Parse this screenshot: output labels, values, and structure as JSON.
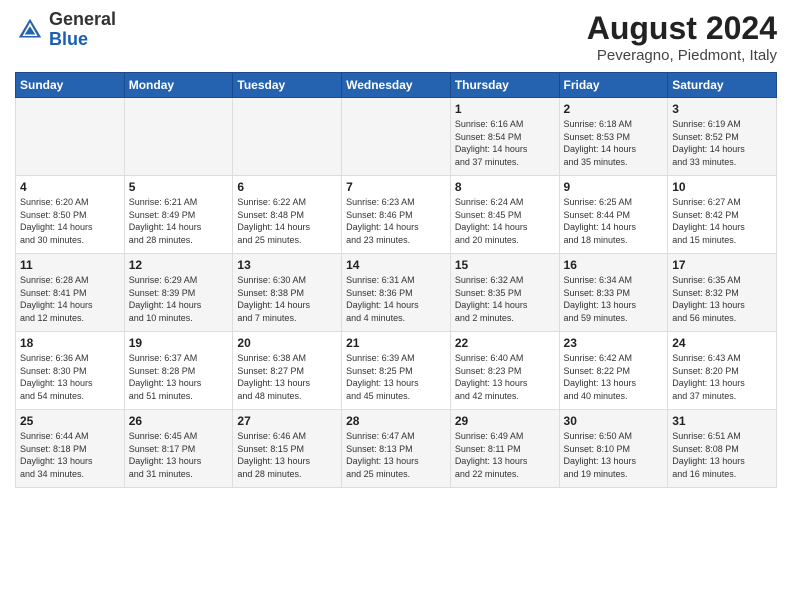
{
  "header": {
    "logo_general": "General",
    "logo_blue": "Blue",
    "month_title": "August 2024",
    "location": "Peveragno, Piedmont, Italy"
  },
  "days_of_week": [
    "Sunday",
    "Monday",
    "Tuesday",
    "Wednesday",
    "Thursday",
    "Friday",
    "Saturday"
  ],
  "weeks": [
    [
      {
        "day": "",
        "info": ""
      },
      {
        "day": "",
        "info": ""
      },
      {
        "day": "",
        "info": ""
      },
      {
        "day": "",
        "info": ""
      },
      {
        "day": "1",
        "info": "Sunrise: 6:16 AM\nSunset: 8:54 PM\nDaylight: 14 hours\nand 37 minutes."
      },
      {
        "day": "2",
        "info": "Sunrise: 6:18 AM\nSunset: 8:53 PM\nDaylight: 14 hours\nand 35 minutes."
      },
      {
        "day": "3",
        "info": "Sunrise: 6:19 AM\nSunset: 8:52 PM\nDaylight: 14 hours\nand 33 minutes."
      }
    ],
    [
      {
        "day": "4",
        "info": "Sunrise: 6:20 AM\nSunset: 8:50 PM\nDaylight: 14 hours\nand 30 minutes."
      },
      {
        "day": "5",
        "info": "Sunrise: 6:21 AM\nSunset: 8:49 PM\nDaylight: 14 hours\nand 28 minutes."
      },
      {
        "day": "6",
        "info": "Sunrise: 6:22 AM\nSunset: 8:48 PM\nDaylight: 14 hours\nand 25 minutes."
      },
      {
        "day": "7",
        "info": "Sunrise: 6:23 AM\nSunset: 8:46 PM\nDaylight: 14 hours\nand 23 minutes."
      },
      {
        "day": "8",
        "info": "Sunrise: 6:24 AM\nSunset: 8:45 PM\nDaylight: 14 hours\nand 20 minutes."
      },
      {
        "day": "9",
        "info": "Sunrise: 6:25 AM\nSunset: 8:44 PM\nDaylight: 14 hours\nand 18 minutes."
      },
      {
        "day": "10",
        "info": "Sunrise: 6:27 AM\nSunset: 8:42 PM\nDaylight: 14 hours\nand 15 minutes."
      }
    ],
    [
      {
        "day": "11",
        "info": "Sunrise: 6:28 AM\nSunset: 8:41 PM\nDaylight: 14 hours\nand 12 minutes."
      },
      {
        "day": "12",
        "info": "Sunrise: 6:29 AM\nSunset: 8:39 PM\nDaylight: 14 hours\nand 10 minutes."
      },
      {
        "day": "13",
        "info": "Sunrise: 6:30 AM\nSunset: 8:38 PM\nDaylight: 14 hours\nand 7 minutes."
      },
      {
        "day": "14",
        "info": "Sunrise: 6:31 AM\nSunset: 8:36 PM\nDaylight: 14 hours\nand 4 minutes."
      },
      {
        "day": "15",
        "info": "Sunrise: 6:32 AM\nSunset: 8:35 PM\nDaylight: 14 hours\nand 2 minutes."
      },
      {
        "day": "16",
        "info": "Sunrise: 6:34 AM\nSunset: 8:33 PM\nDaylight: 13 hours\nand 59 minutes."
      },
      {
        "day": "17",
        "info": "Sunrise: 6:35 AM\nSunset: 8:32 PM\nDaylight: 13 hours\nand 56 minutes."
      }
    ],
    [
      {
        "day": "18",
        "info": "Sunrise: 6:36 AM\nSunset: 8:30 PM\nDaylight: 13 hours\nand 54 minutes."
      },
      {
        "day": "19",
        "info": "Sunrise: 6:37 AM\nSunset: 8:28 PM\nDaylight: 13 hours\nand 51 minutes."
      },
      {
        "day": "20",
        "info": "Sunrise: 6:38 AM\nSunset: 8:27 PM\nDaylight: 13 hours\nand 48 minutes."
      },
      {
        "day": "21",
        "info": "Sunrise: 6:39 AM\nSunset: 8:25 PM\nDaylight: 13 hours\nand 45 minutes."
      },
      {
        "day": "22",
        "info": "Sunrise: 6:40 AM\nSunset: 8:23 PM\nDaylight: 13 hours\nand 42 minutes."
      },
      {
        "day": "23",
        "info": "Sunrise: 6:42 AM\nSunset: 8:22 PM\nDaylight: 13 hours\nand 40 minutes."
      },
      {
        "day": "24",
        "info": "Sunrise: 6:43 AM\nSunset: 8:20 PM\nDaylight: 13 hours\nand 37 minutes."
      }
    ],
    [
      {
        "day": "25",
        "info": "Sunrise: 6:44 AM\nSunset: 8:18 PM\nDaylight: 13 hours\nand 34 minutes."
      },
      {
        "day": "26",
        "info": "Sunrise: 6:45 AM\nSunset: 8:17 PM\nDaylight: 13 hours\nand 31 minutes."
      },
      {
        "day": "27",
        "info": "Sunrise: 6:46 AM\nSunset: 8:15 PM\nDaylight: 13 hours\nand 28 minutes."
      },
      {
        "day": "28",
        "info": "Sunrise: 6:47 AM\nSunset: 8:13 PM\nDaylight: 13 hours\nand 25 minutes."
      },
      {
        "day": "29",
        "info": "Sunrise: 6:49 AM\nSunset: 8:11 PM\nDaylight: 13 hours\nand 22 minutes."
      },
      {
        "day": "30",
        "info": "Sunrise: 6:50 AM\nSunset: 8:10 PM\nDaylight: 13 hours\nand 19 minutes."
      },
      {
        "day": "31",
        "info": "Sunrise: 6:51 AM\nSunset: 8:08 PM\nDaylight: 13 hours\nand 16 minutes."
      }
    ]
  ]
}
